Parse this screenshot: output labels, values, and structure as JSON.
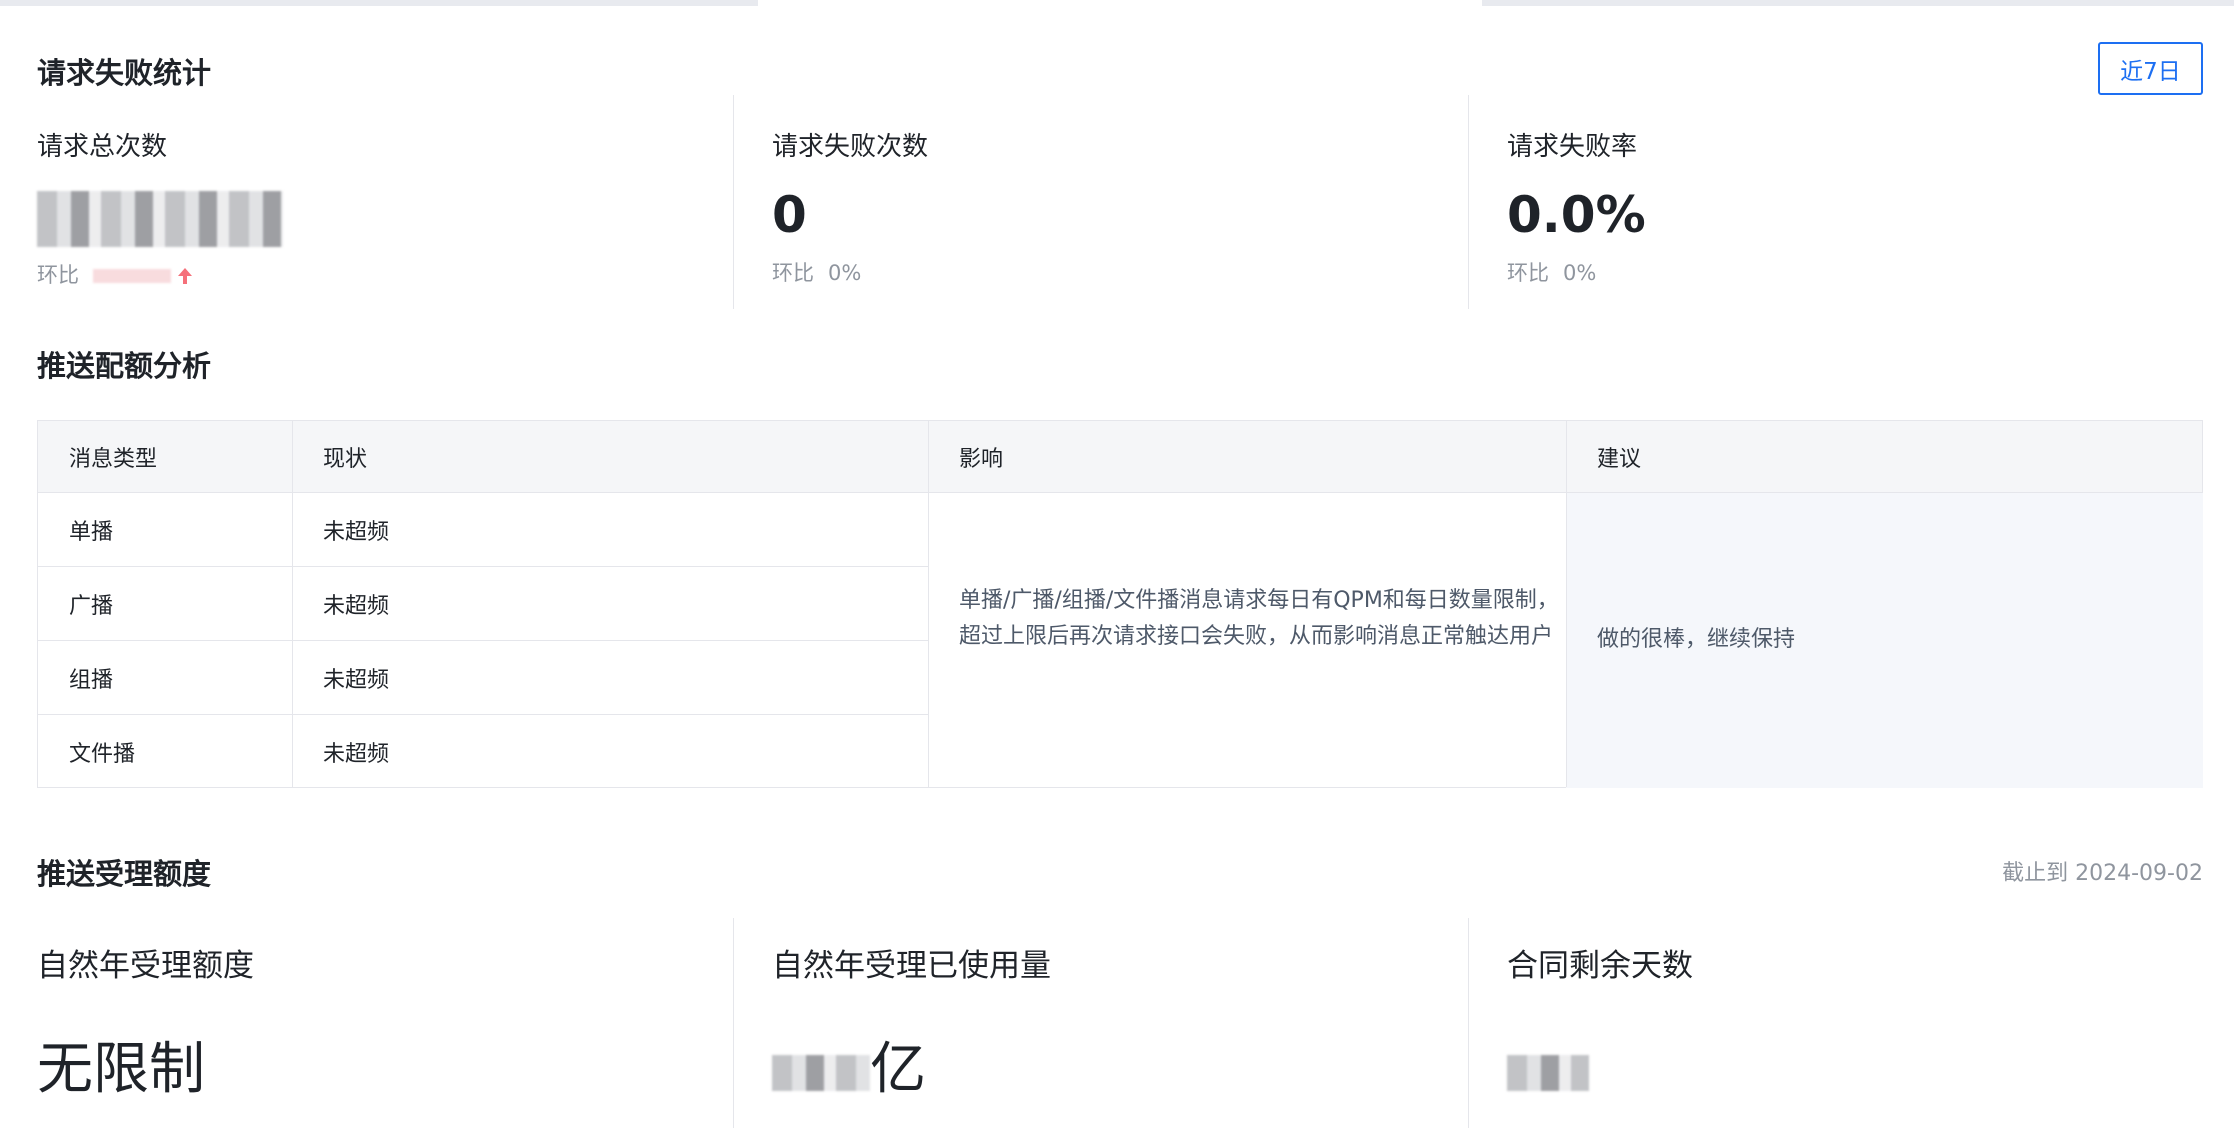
{
  "failure_stats": {
    "title": "请求失败统计",
    "range_button": "近7日",
    "cards": [
      {
        "label": "请求总次数",
        "value": "",
        "compare_label": "环比",
        "compare_value": ""
      },
      {
        "label": "请求失败次数",
        "value": "0",
        "compare_label": "环比",
        "compare_value": "0%"
      },
      {
        "label": "请求失败率",
        "value": "0.0%",
        "compare_label": "环比",
        "compare_value": "0%"
      }
    ],
    "trend_icon": "arrow-up-icon",
    "trend_color": "#f5707a"
  },
  "quota_analysis": {
    "title": "推送配额分析",
    "headers": [
      "消息类型",
      "现状",
      "影响",
      "建议"
    ],
    "rows": [
      {
        "type": "单播",
        "status": "未超频"
      },
      {
        "type": "广播",
        "status": "未超频"
      },
      {
        "type": "组播",
        "status": "未超频"
      },
      {
        "type": "文件播",
        "status": "未超频"
      }
    ],
    "impact": "单播/广播/组播/文件播消息请求每日有QPM和每日数量限制，超过上限后再次请求接口会失败，从而影响消息正常触达用户",
    "suggestion": "做的很棒，继续保持"
  },
  "acceptance_quota": {
    "title": "推送受理额度",
    "cutoff": "截止到 2024-09-02",
    "cards": [
      {
        "label": "自然年受理额度",
        "value": "无限制"
      },
      {
        "label": "自然年受理已使用量",
        "value_suffix": "亿"
      },
      {
        "label": "合同剩余天数",
        "value": ""
      }
    ]
  },
  "colors": {
    "accent": "#1d6ff2",
    "table_header_bg": "#f5f6f8",
    "suggestion_bg": "#f5f7fb"
  }
}
